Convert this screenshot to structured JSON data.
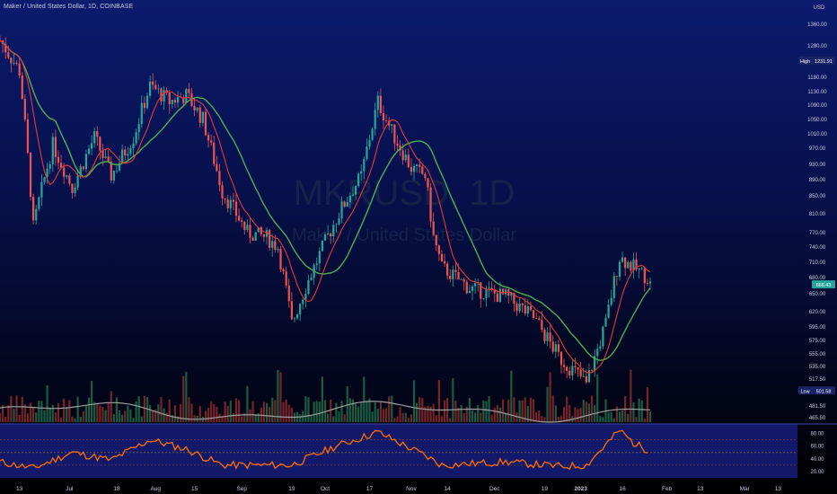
{
  "header": {
    "symbol_line": "Maker / United States Dollar, 1D, COINBASE",
    "watermark_ticker": "MKRUSD, 1D",
    "watermark_name": "Maker / United States Dollar"
  },
  "axis": {
    "currency": "USD",
    "price_ticks": [
      "1360.00",
      "1280.00",
      "1180.00",
      "1130.00",
      "1090.00",
      "1050.00",
      "1010.00",
      "970.00",
      "930.00",
      "890.00",
      "850.00",
      "810.00",
      "770.00",
      "740.00",
      "710.00",
      "680.00",
      "650.00",
      "620.00",
      "595.00",
      "575.00",
      "555.00",
      "535.00",
      "517.50",
      "481.50",
      "465.50"
    ],
    "high_label": "High",
    "high_value": "1231.91",
    "low_label": "Low",
    "low_value": "501.58",
    "last_price": "666.43",
    "date_ticks": [
      "13",
      "Jul",
      "18",
      "Aug",
      "15",
      "Sep",
      "19",
      "Oct",
      "17",
      "Nov",
      "14",
      "Dec",
      "19",
      "2023",
      "16",
      "Feb",
      "13",
      "Mar",
      "13"
    ],
    "rsi_ticks": [
      "80.00",
      "60.00",
      "40.00",
      "20.00"
    ]
  },
  "colors": {
    "up": "#26a69a",
    "down": "#ef5350",
    "ma_fast": "#e53935",
    "ma_slow": "#4caf50",
    "volume_ma": "#9e9e9e",
    "rsi_line": "#ff6d00",
    "last_price_badge": "#26a69a",
    "rsi_band": "#12196a"
  },
  "chart_data": [
    {
      "type": "line",
      "title": "Maker / United States Dollar, 1D, COINBASE",
      "x_range": [
        "2022-06-06",
        "2023-03-20"
      ],
      "ylim": [
        465.5,
        1400
      ],
      "price_key_points": [
        {
          "x": "2022-06-06",
          "y": 1300
        },
        {
          "x": "2022-06-13",
          "y": 1200
        },
        {
          "x": "2022-06-18",
          "y": 780
        },
        {
          "x": "2022-06-25",
          "y": 980
        },
        {
          "x": "2022-07-02",
          "y": 870
        },
        {
          "x": "2022-07-10",
          "y": 1000
        },
        {
          "x": "2022-07-16",
          "y": 900
        },
        {
          "x": "2022-07-24",
          "y": 1000
        },
        {
          "x": "2022-07-30",
          "y": 1150
        },
        {
          "x": "2022-08-06",
          "y": 1100
        },
        {
          "x": "2022-08-12",
          "y": 1120
        },
        {
          "x": "2022-08-18",
          "y": 1050
        },
        {
          "x": "2022-08-25",
          "y": 860
        },
        {
          "x": "2022-09-03",
          "y": 770
        },
        {
          "x": "2022-09-10",
          "y": 760
        },
        {
          "x": "2022-09-14",
          "y": 740
        },
        {
          "x": "2022-09-19",
          "y": 600
        },
        {
          "x": "2022-09-27",
          "y": 700
        },
        {
          "x": "2022-10-05",
          "y": 800
        },
        {
          "x": "2022-10-14",
          "y": 900
        },
        {
          "x": "2022-10-20",
          "y": 1100
        },
        {
          "x": "2022-10-26",
          "y": 1000
        },
        {
          "x": "2022-11-01",
          "y": 920
        },
        {
          "x": "2022-11-06",
          "y": 900
        },
        {
          "x": "2022-11-09",
          "y": 760
        },
        {
          "x": "2022-11-12",
          "y": 700
        },
        {
          "x": "2022-11-22",
          "y": 660
        },
        {
          "x": "2022-12-05",
          "y": 645
        },
        {
          "x": "2022-12-15",
          "y": 610
        },
        {
          "x": "2022-12-25",
          "y": 545
        },
        {
          "x": "2023-01-01",
          "y": 520
        },
        {
          "x": "2023-01-03",
          "y": 510
        },
        {
          "x": "2023-01-10",
          "y": 600
        },
        {
          "x": "2023-01-15",
          "y": 720
        },
        {
          "x": "2023-01-20",
          "y": 700
        },
        {
          "x": "2023-01-25",
          "y": 680
        },
        {
          "x": "2023-01-26",
          "y": 666.43
        }
      ],
      "rsi_key_points": [
        {
          "x": "2022-06-06",
          "y": 35
        },
        {
          "x": "2022-06-18",
          "y": 25
        },
        {
          "x": "2022-07-02",
          "y": 50
        },
        {
          "x": "2022-07-16",
          "y": 38
        },
        {
          "x": "2022-07-30",
          "y": 70
        },
        {
          "x": "2022-08-12",
          "y": 55
        },
        {
          "x": "2022-08-25",
          "y": 30
        },
        {
          "x": "2022-09-19",
          "y": 30
        },
        {
          "x": "2022-10-05",
          "y": 60
        },
        {
          "x": "2022-10-20",
          "y": 82
        },
        {
          "x": "2022-11-06",
          "y": 45
        },
        {
          "x": "2022-11-12",
          "y": 30
        },
        {
          "x": "2022-12-05",
          "y": 35
        },
        {
          "x": "2022-12-25",
          "y": 28
        },
        {
          "x": "2023-01-03",
          "y": 30
        },
        {
          "x": "2023-01-15",
          "y": 85
        },
        {
          "x": "2023-01-20",
          "y": 65
        },
        {
          "x": "2023-01-26",
          "y": 52
        }
      ],
      "rsi_levels": [
        70,
        50,
        30
      ],
      "rsi_ylim": [
        10,
        95
      ]
    }
  ]
}
